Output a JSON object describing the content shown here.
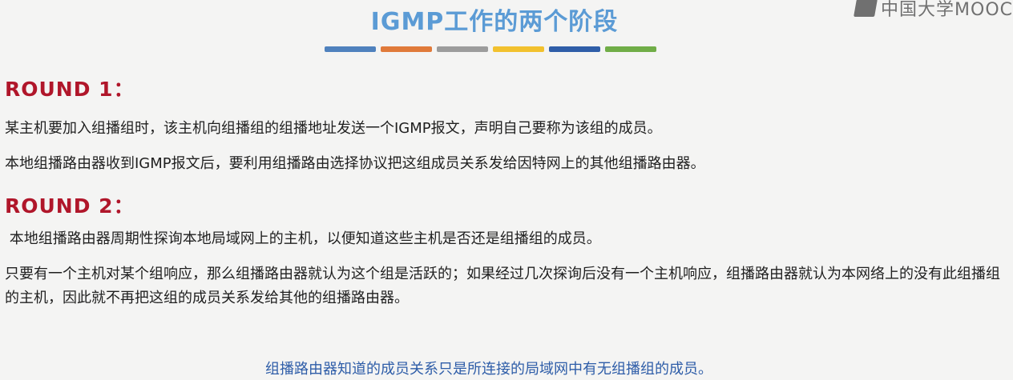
{
  "watermark": {
    "text": "中国大学MOOC"
  },
  "slide": {
    "title": "IGMP工作的两个阶段",
    "accent_bars": [
      "#4f81bd",
      "#e07a3a",
      "#9c9c9c",
      "#f2c12e",
      "#2f5ea8",
      "#70ad47"
    ],
    "rounds": [
      {
        "heading": "ROUND 1：",
        "paragraphs": [
          "某主机要加入组播组时，该主机向组播组的组播地址发送一个IGMP报文，声明自己要称为该组的成员。",
          "本地组播路由器收到IGMP报文后，要利用组播路由选择协议把这组成员关系发给因特网上的其他组播路由器。"
        ]
      },
      {
        "heading": "ROUND 2：",
        "paragraphs": [
          " 本地组播路由器周期性探询本地局域网上的主机，以便知道这些主机是否还是组播组的成员。",
          "只要有一个主机对某个组响应，那么组播路由器就认为这个组是活跃的；如果经过几次探询后没有一个主机响应，组播路由器就认为本网络上的没有此组播组的主机，因此就不再把这组的成员关系发给其他的组播路由器。"
        ]
      }
    ],
    "note": "组播路由器知道的成员关系只是所连接的局域网中有无组播组的成员。"
  }
}
